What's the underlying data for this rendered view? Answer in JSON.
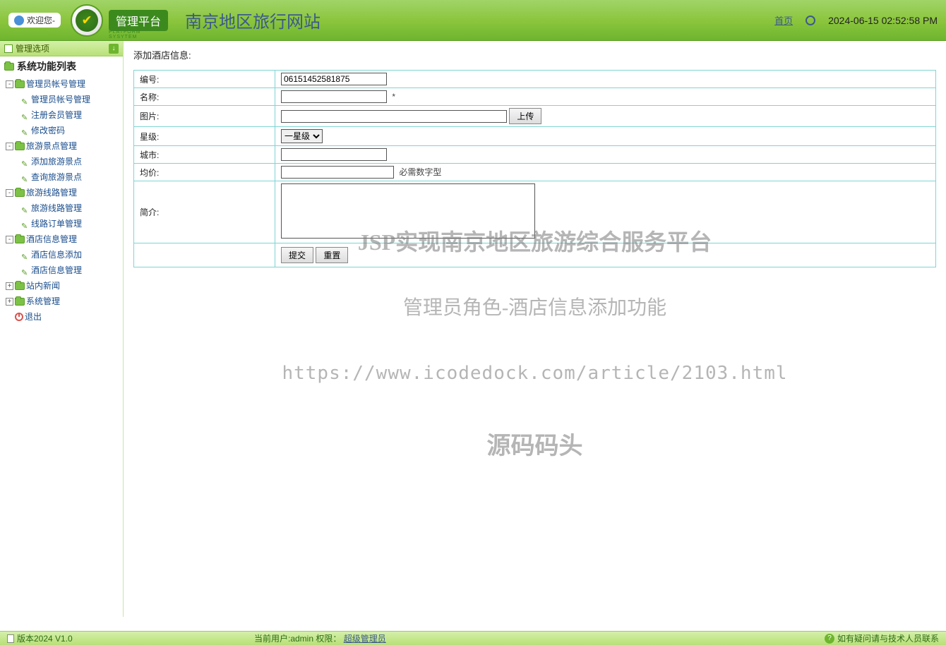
{
  "header": {
    "welcome": "欢迎您-",
    "platform_label": "管理平台",
    "platform_sub": "PLATFORM SYSYTEM",
    "site_title": "南京地区旅行网站",
    "home_link": "首页",
    "datetime": "2024-06-15 02:52:58 PM"
  },
  "sidebar": {
    "mgmt_options": "管理选项",
    "func_list_title": "系统功能列表",
    "groups": [
      {
        "toggle": "-",
        "label": "管理员帐号管理",
        "children": [
          {
            "label": "管理员帐号管理"
          },
          {
            "label": "注册会员管理"
          },
          {
            "label": "修改密码"
          }
        ]
      },
      {
        "toggle": "-",
        "label": "旅游景点管理",
        "children": [
          {
            "label": "添加旅游景点"
          },
          {
            "label": "查询旅游景点"
          }
        ]
      },
      {
        "toggle": "-",
        "label": "旅游线路管理",
        "children": [
          {
            "label": "旅游线路管理"
          },
          {
            "label": "线路订单管理"
          }
        ]
      },
      {
        "toggle": "-",
        "label": "酒店信息管理",
        "children": [
          {
            "label": "酒店信息添加"
          },
          {
            "label": "酒店信息管理"
          }
        ]
      },
      {
        "toggle": "+",
        "label": "站内新闻",
        "children": []
      },
      {
        "toggle": "+",
        "label": "系统管理",
        "children": []
      }
    ],
    "logout": "退出"
  },
  "main": {
    "heading": "添加酒店信息:",
    "fields": {
      "number_label": "编号:",
      "number_value": "06151452581875",
      "name_label": "名称:",
      "name_required": "*",
      "image_label": "图片:",
      "upload_btn": "上传",
      "star_label": "星级:",
      "star_value": "一星级",
      "city_label": "城市:",
      "price_label": "均价:",
      "price_hint": "必需数字型",
      "desc_label": "简介:",
      "submit_btn": "提交",
      "reset_btn": "重置"
    }
  },
  "watermark": {
    "line1": "JSP实现南京地区旅游综合服务平台",
    "line2": "管理员角色-酒店信息添加功能",
    "line3": "https://www.icodedock.com/article/2103.html",
    "line4": "源码码头"
  },
  "footer": {
    "version": "版本2024 V1.0",
    "current_user_label": "当前用户:admin 权限：",
    "role": "超级管理员",
    "help_text": "如有疑问请与技术人员联系"
  }
}
